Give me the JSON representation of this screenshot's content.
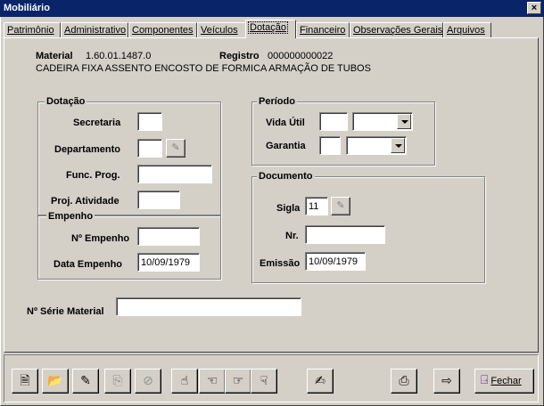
{
  "window": {
    "title": "Mobiliário",
    "close_glyph": "×"
  },
  "tabs": [
    {
      "label": "Patrimônio"
    },
    {
      "label": "Administrativo"
    },
    {
      "label": "Componentes"
    },
    {
      "label": "Veículos"
    },
    {
      "label": "Dotação",
      "active": true
    },
    {
      "label": "Financeiro"
    },
    {
      "label": "Observações Gerais"
    },
    {
      "label": "Arquivos"
    }
  ],
  "header": {
    "material_label": "Material",
    "material_value": "1.60.01.1487.0",
    "registro_label": "Registro",
    "registro_value": "000000000022",
    "description": "CADEIRA FIXA ASSENTO ENCOSTO DE FORMICA ARMAÇÃO DE TUBOS"
  },
  "dotacao": {
    "title": "Dotação",
    "secretaria_label": "Secretaria",
    "secretaria_value": "",
    "departamento_label": "Departamento",
    "departamento_value": "",
    "func_prog_label": "Func. Prog.",
    "func_prog_value": "",
    "proj_atividade_label": "Proj. Atividade",
    "proj_atividade_value": ""
  },
  "empenho": {
    "title": "Empenho",
    "numero_label": "Nº Empenho",
    "numero_value": "",
    "data_label": "Data Empenho",
    "data_value": "10/09/1979"
  },
  "periodo": {
    "title": "Período",
    "vida_util_label": "Vida Útil",
    "vida_util_value": "",
    "vida_util_unit": "",
    "garantia_label": "Garantia",
    "garantia_value": "",
    "garantia_unit": ""
  },
  "documento": {
    "title": "Documento",
    "sigla_label": "Sigla",
    "sigla_value": "11",
    "nr_label": "Nr.",
    "nr_value": "",
    "emissao_label": "Emissão",
    "emissao_value": "10/09/1979"
  },
  "serie": {
    "label": "Nº Série Material",
    "value": ""
  },
  "toolbar": {
    "buttons": [
      {
        "icon": "new-record-icon",
        "glyph": "🗎"
      },
      {
        "icon": "open-folder-icon",
        "glyph": "📂"
      },
      {
        "icon": "edit-icon",
        "glyph": "✎"
      },
      {
        "icon": "copy-icon",
        "glyph": "⎘"
      },
      {
        "icon": "delete-icon",
        "glyph": "⊘"
      },
      {
        "icon": "first-record-icon",
        "glyph": "☝"
      },
      {
        "icon": "previous-record-icon",
        "glyph": "☜"
      },
      {
        "icon": "next-record-icon",
        "glyph": "☞"
      },
      {
        "icon": "last-record-icon",
        "glyph": "☟"
      },
      {
        "icon": "notes-icon",
        "glyph": "✍"
      },
      {
        "icon": "print-icon",
        "glyph": "⎙"
      },
      {
        "icon": "export-icon",
        "glyph": "⇨"
      }
    ],
    "close_label": "Fechar",
    "close_icon": "exit-door-icon",
    "close_glyph": "⍈"
  },
  "colors": {
    "title_bar": "#0a246a",
    "face": "#d4d0c8"
  }
}
